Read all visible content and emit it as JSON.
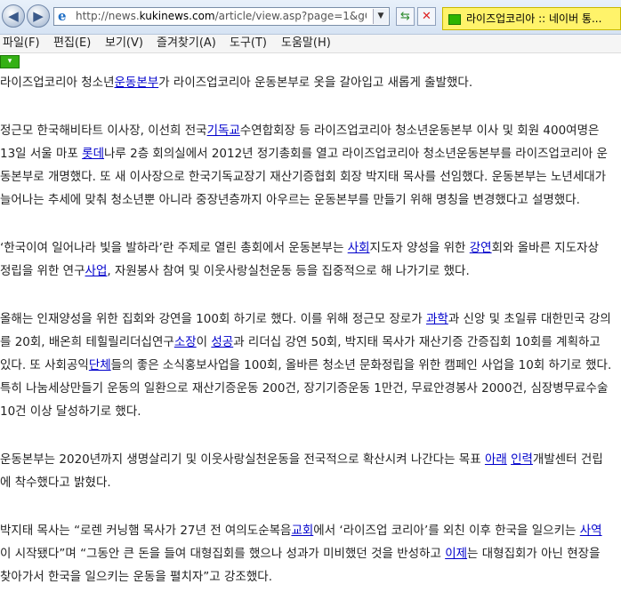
{
  "browser": {
    "url_prefix": "http://news.",
    "url_domain": "kukinews.com",
    "url_suffix": "/article/view.asp?page=1&gC",
    "tab_title": "라이즈업코리아 :: 네이버 통..."
  },
  "menu": [
    "파일(F)",
    "편집(E)",
    "보기(V)",
    "즐겨찾기(A)",
    "도구(T)",
    "도움말(H)"
  ],
  "article": {
    "p1": [
      "라이즈업코리아 청소년",
      "운동본부",
      "가 라이즈업코리아 운동본부로 옷을 갈아입고 새롭게 출발했다."
    ],
    "p2": [
      "정근모 한국해비타트 이사장, 이선희 전국",
      "기독교",
      "수연합회장 등 라이즈업코리아 청소년운동본부 이사 및 회원 400여명은 13일 서울 마포 ",
      "롯데",
      "나루 2층 회의실에서 2012년 정기총회를 열고 라이즈업코리아 청소년운동본부를 라이즈업코리아 운동본부로 개명했다. 또 새 이사장으로 한국기독교장기 재산기증협회 회장 박지태 목사를 선임했다. 운동본부는 노년세대가 늘어나는 추세에 맞춰 청소년뿐 아니라 중장년층까지 아우르는 운동본부를 만들기 위해 명칭을 변경했다고 설명했다."
    ],
    "p3": [
      "‘한국이여 일어나라 빛을 발하라’란 주제로 열린 총회에서 운동본부는 ",
      "사회",
      "지도자 양성을 위한 ",
      "강연",
      "회와 올바른 지도자상 정립을 위한 연구",
      "사업",
      ", 자원봉사 참여 및 이웃사랑실천운동 등을 집중적으로 해 나가기로 했다."
    ],
    "p4": [
      "올해는 인재양성을 위한 집회와 강연을 100회 하기로 했다. 이를 위해 정근모 장로가 ",
      "과학",
      "과 신앙 및 초일류 대한민국 강의를 20회, 배온희 테힐릴리더십연구",
      "소장",
      "이 ",
      "성공",
      "과 리더십 강연 50회, 박지태 목사가 재산기증 간증집회 10회를 계획하고 있다. 또 사회공익",
      "단체",
      "들의 좋은 소식홍보사업을 100회, 올바른 청소년 문화정립을 위한 캠페인 사업을 10회 하기로 했다. 특히 나눔세상만들기 운동의 일환으로 재산기증운동 200건, 장기기증운동 1만건, 무료안경봉사 2000건, 심장병무료수술 10건 이상 달성하기로 했다."
    ],
    "p5": [
      "운동본부는 2020년까지 생명살리기 및 이웃사랑실천운동을 전국적으로 확산시켜 나간다는 목표 ",
      "아래",
      " ",
      "인력",
      "개발센터 건립에 착수했다고 밝혔다."
    ],
    "p6": [
      "박지태 목사는 “로렌 커닝햄 목사가 27년 전 여의도순복음",
      "교회",
      "에서 ‘라이즈업 코리아’를 외친 이후 한국을 일으키는 ",
      "사역",
      "이 시작됐다”며 “그동안 큰 돈을 들여 대형집회를 했으나 성과가 미비했던 것을 반성하고 ",
      "이제",
      "는 대형집회가 아닌 현장을 찾아가서 한국을 일으키는 운동을 펼치자”고 강조했다."
    ]
  }
}
